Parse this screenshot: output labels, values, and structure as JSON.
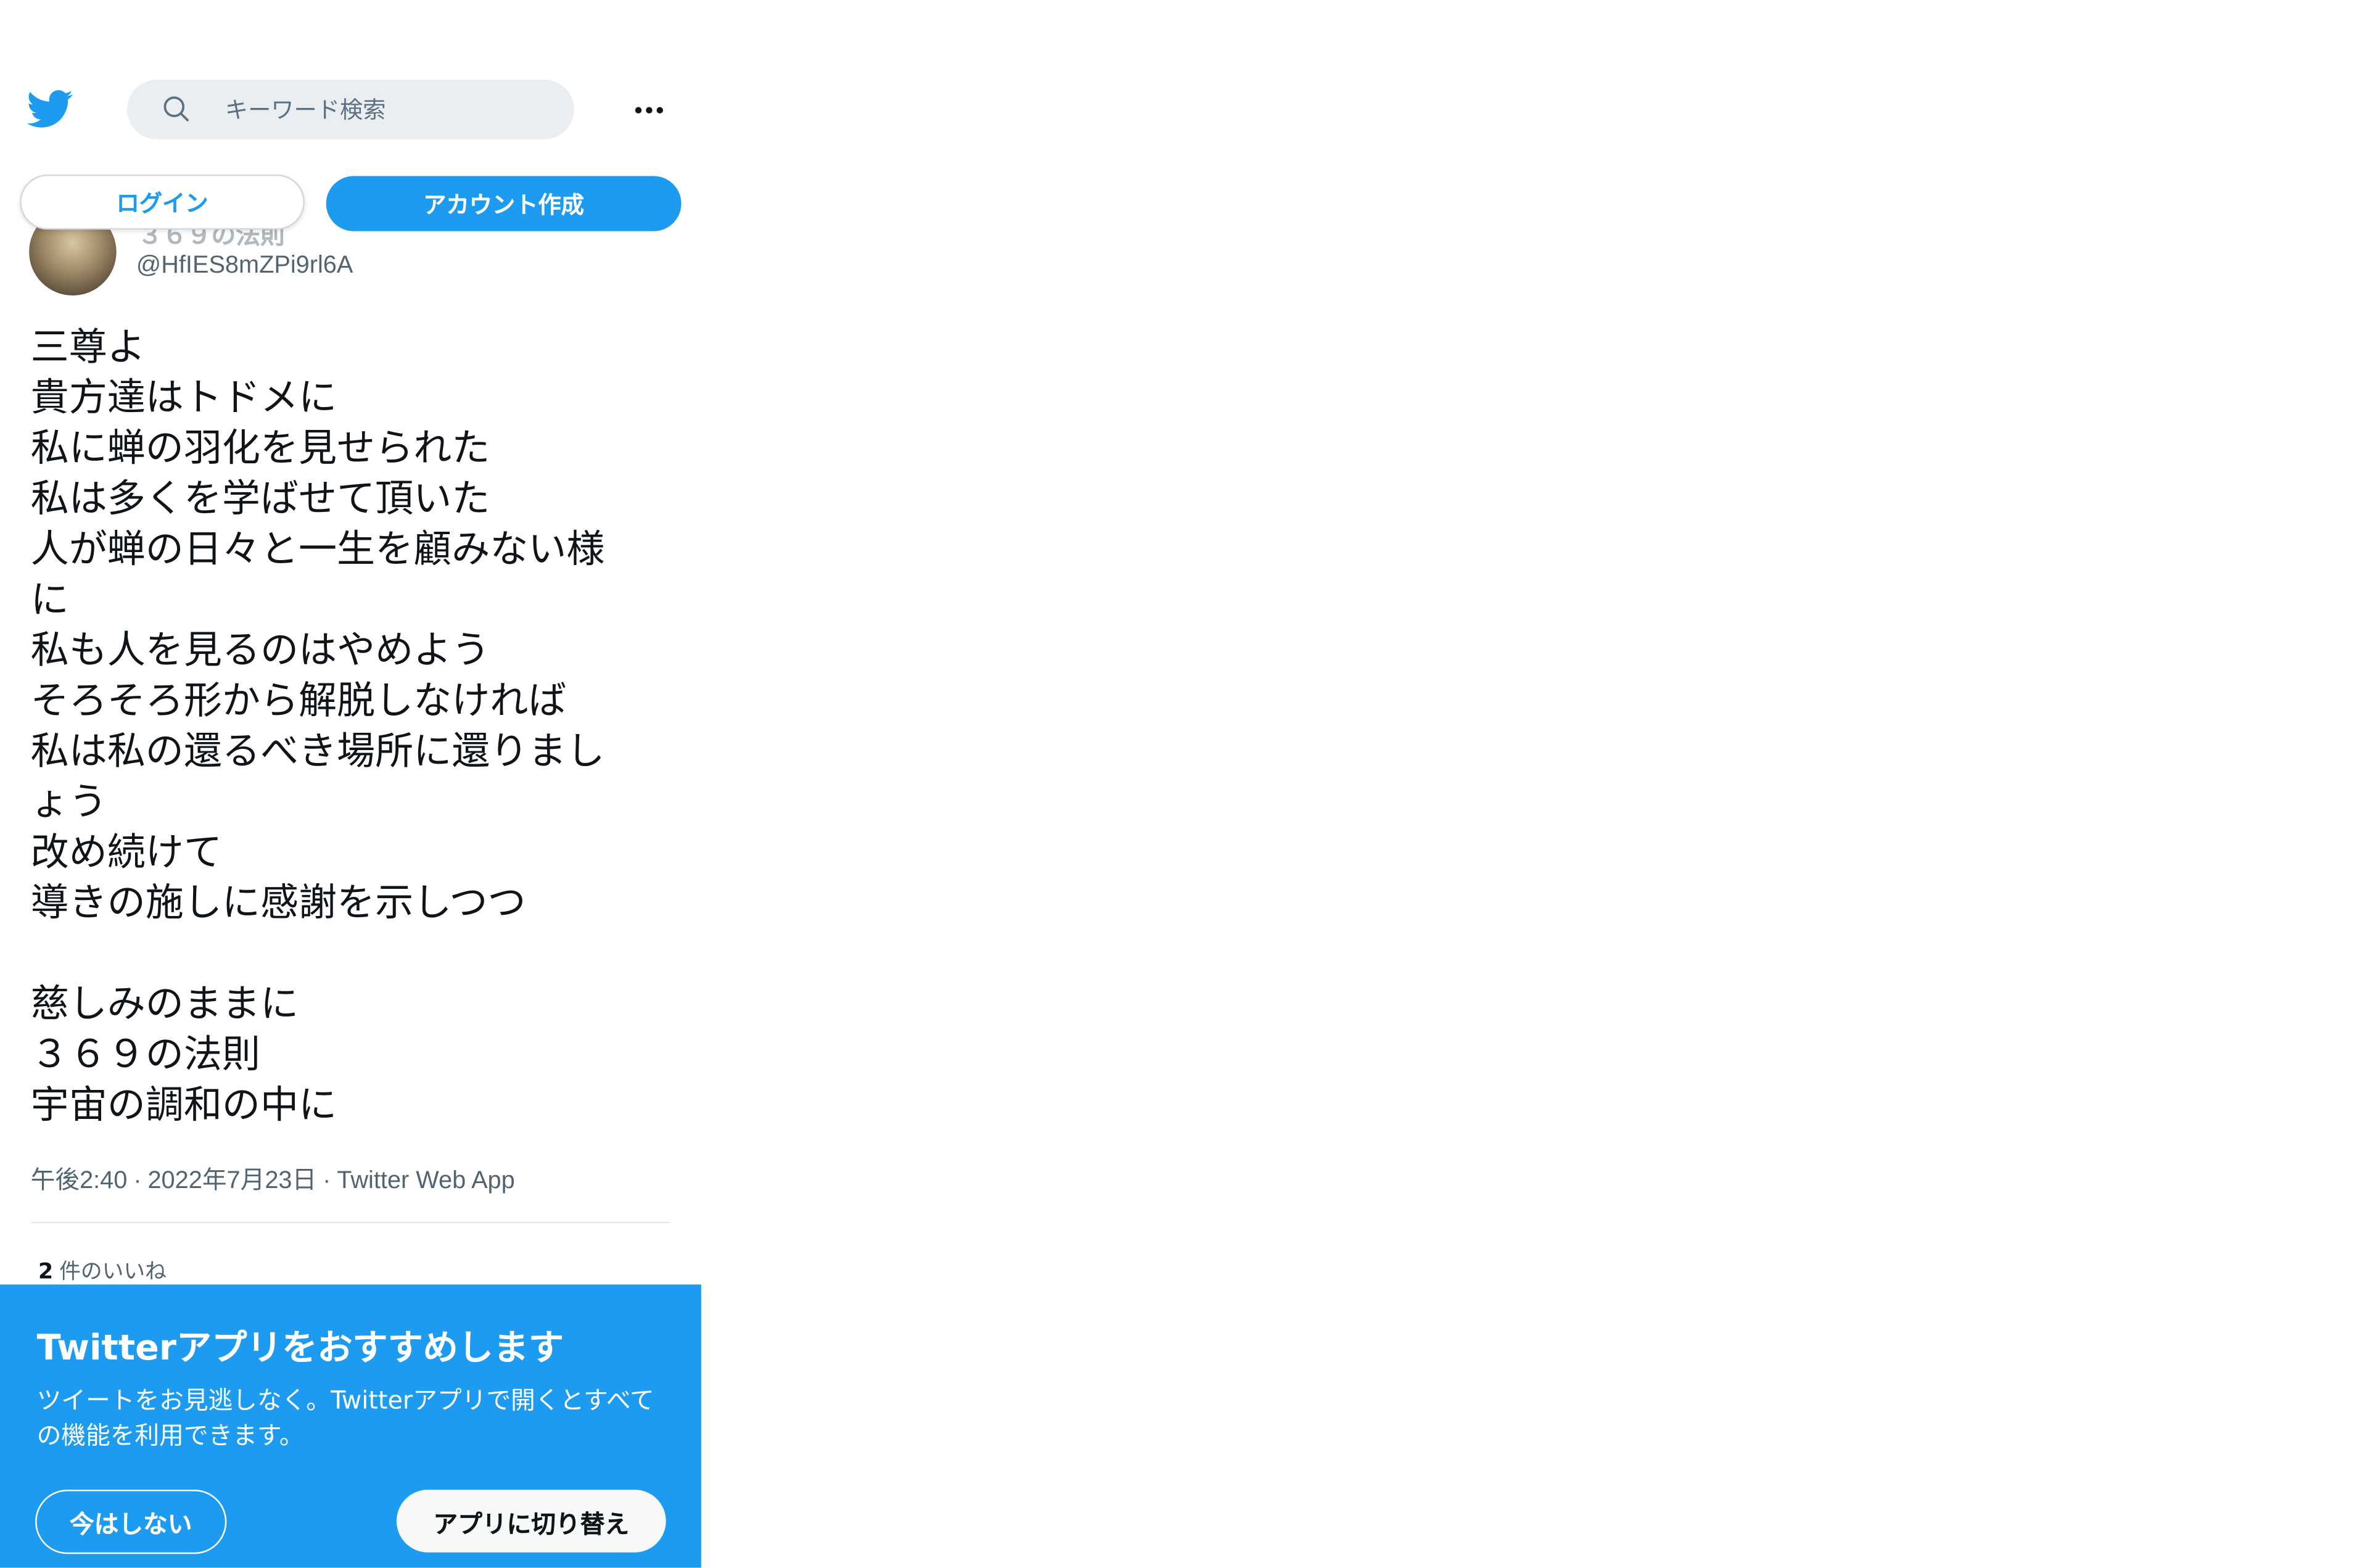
{
  "header": {
    "search_placeholder": "キーワード検索"
  },
  "auth": {
    "login_label": "ログイン",
    "signup_label": "アカウント作成"
  },
  "author": {
    "name": "３６９の法則",
    "handle": "@HfIES8mZPi9rl6A"
  },
  "tweet": {
    "lines": [
      "三尊よ",
      "貴方達はトドメに",
      "私に蝉の羽化を見せられた",
      "私は多くを学ばせて頂いた",
      "人が蝉の日々と一生を顧みない様",
      "に",
      "私も人を見るのはやめよう",
      "そろそろ形から解脱しなければ",
      "私は私の還るべき場所に還りまし",
      "ょう",
      "改め続けて",
      "導きの施しに感謝を示しつつ",
      "",
      "慈しみのままに",
      "３６９の法則",
      "宇宙の調和の中に"
    ],
    "time": "午後2:40",
    "date": "2022年7月23日",
    "source": "Twitter Web App",
    "separator": "·",
    "likes_count": "2",
    "likes_label": "件のいいね"
  },
  "promo": {
    "title": "Twitterアプリをおすすめします",
    "text": "ツイートをお見逃しなく。Twitterアプリで開くとすべての機能を利用できます。",
    "not_now_label": "今はしない",
    "switch_label": "アプリに切り替え"
  },
  "colors": {
    "brand_blue": "#1d9bf0",
    "text_primary": "#0f1419",
    "text_secondary": "#536471"
  },
  "icons": {
    "logo": "twitter-bird-icon",
    "search": "search-icon",
    "more": "more-icon"
  }
}
